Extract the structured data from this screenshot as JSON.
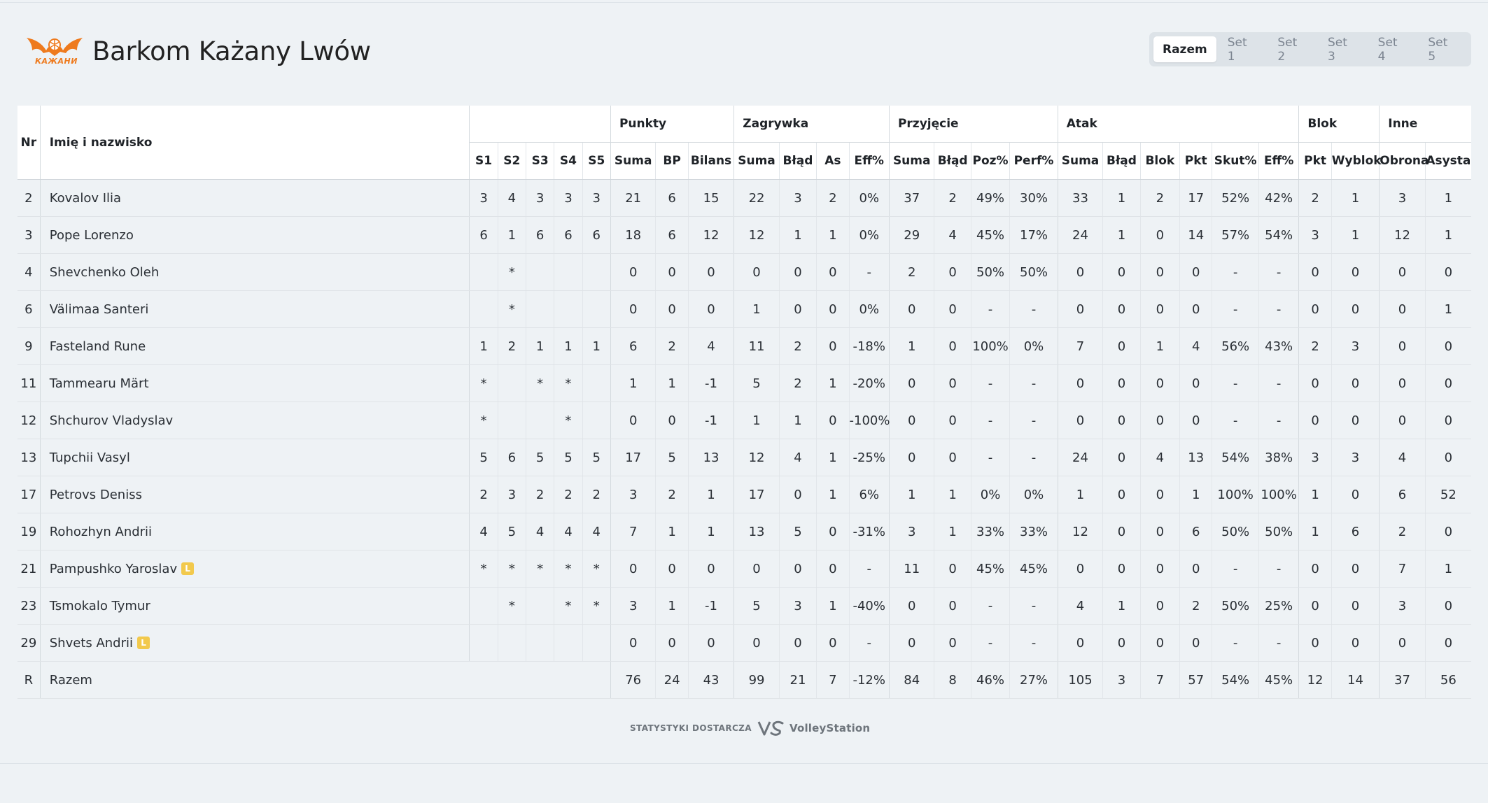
{
  "header": {
    "logo_text": "КАЖАНИ",
    "team_name": "Barkom Każany Lwów"
  },
  "tabs": [
    {
      "label": "Razem",
      "active": true
    },
    {
      "label": "Set 1",
      "active": false
    },
    {
      "label": "Set 2",
      "active": false
    },
    {
      "label": "Set 3",
      "active": false
    },
    {
      "label": "Set 4",
      "active": false
    },
    {
      "label": "Set 5",
      "active": false
    }
  ],
  "table": {
    "head": {
      "nr": "Nr",
      "name": "Imię i nazwisko",
      "groups": {
        "punkty": "Punkty",
        "zagrywka": "Zagrywka",
        "przyjecie": "Przyjęcie",
        "atak": "Atak",
        "blok": "Blok",
        "inne": "Inne"
      },
      "sets": [
        "S1",
        "S2",
        "S3",
        "S4",
        "S5"
      ],
      "punkty": [
        "Suma",
        "BP",
        "Bilans"
      ],
      "zagrywka": [
        "Suma",
        "Błąd",
        "As",
        "Eff%"
      ],
      "przyjecie": [
        "Suma",
        "Błąd",
        "Poz%",
        "Perf%"
      ],
      "atak": [
        "Suma",
        "Błąd",
        "Blok",
        "Pkt",
        "Skut%",
        "Eff%"
      ],
      "blok": [
        "Pkt",
        "Wyblok"
      ],
      "inne": [
        "Obrona",
        "Asysta"
      ]
    },
    "rows": [
      {
        "nr": "2",
        "name": "Kovalov Ilia",
        "libero": false,
        "sets": [
          "3",
          "4",
          "3",
          "3",
          "3"
        ],
        "punkty": [
          "21",
          "6",
          "15"
        ],
        "zagrywka": [
          "22",
          "3",
          "2",
          "0%"
        ],
        "przyjecie": [
          "37",
          "2",
          "49%",
          "30%"
        ],
        "atak": [
          "33",
          "1",
          "2",
          "17",
          "52%",
          "42%"
        ],
        "blok": [
          "2",
          "1"
        ],
        "inne": [
          "3",
          "1"
        ]
      },
      {
        "nr": "3",
        "name": "Pope Lorenzo",
        "libero": false,
        "sets": [
          "6",
          "1",
          "6",
          "6",
          "6"
        ],
        "punkty": [
          "18",
          "6",
          "12"
        ],
        "zagrywka": [
          "12",
          "1",
          "1",
          "0%"
        ],
        "przyjecie": [
          "29",
          "4",
          "45%",
          "17%"
        ],
        "atak": [
          "24",
          "1",
          "0",
          "14",
          "57%",
          "54%"
        ],
        "blok": [
          "3",
          "1"
        ],
        "inne": [
          "12",
          "1"
        ]
      },
      {
        "nr": "4",
        "name": "Shevchenko Oleh",
        "libero": false,
        "sets": [
          "",
          "*",
          "",
          "",
          ""
        ],
        "punkty": [
          "0",
          "0",
          "0"
        ],
        "zagrywka": [
          "0",
          "0",
          "0",
          "-"
        ],
        "przyjecie": [
          "2",
          "0",
          "50%",
          "50%"
        ],
        "atak": [
          "0",
          "0",
          "0",
          "0",
          "-",
          "-"
        ],
        "blok": [
          "0",
          "0"
        ],
        "inne": [
          "0",
          "0"
        ]
      },
      {
        "nr": "6",
        "name": "Välimaa Santeri",
        "libero": false,
        "sets": [
          "",
          "*",
          "",
          "",
          ""
        ],
        "punkty": [
          "0",
          "0",
          "0"
        ],
        "zagrywka": [
          "1",
          "0",
          "0",
          "0%"
        ],
        "przyjecie": [
          "0",
          "0",
          "-",
          "-"
        ],
        "atak": [
          "0",
          "0",
          "0",
          "0",
          "-",
          "-"
        ],
        "blok": [
          "0",
          "0"
        ],
        "inne": [
          "0",
          "1"
        ]
      },
      {
        "nr": "9",
        "name": "Fasteland Rune",
        "libero": false,
        "sets": [
          "1",
          "2",
          "1",
          "1",
          "1"
        ],
        "punkty": [
          "6",
          "2",
          "4"
        ],
        "zagrywka": [
          "11",
          "2",
          "0",
          "-18%"
        ],
        "przyjecie": [
          "1",
          "0",
          "100%",
          "0%"
        ],
        "atak": [
          "7",
          "0",
          "1",
          "4",
          "56%",
          "43%"
        ],
        "blok": [
          "2",
          "3"
        ],
        "inne": [
          "0",
          "0"
        ]
      },
      {
        "nr": "11",
        "name": "Tammearu Märt",
        "libero": false,
        "sets": [
          "*",
          "",
          "*",
          "*",
          ""
        ],
        "punkty": [
          "1",
          "1",
          "-1"
        ],
        "zagrywka": [
          "5",
          "2",
          "1",
          "-20%"
        ],
        "przyjecie": [
          "0",
          "0",
          "-",
          "-"
        ],
        "atak": [
          "0",
          "0",
          "0",
          "0",
          "-",
          "-"
        ],
        "blok": [
          "0",
          "0"
        ],
        "inne": [
          "0",
          "0"
        ]
      },
      {
        "nr": "12",
        "name": "Shchurov Vladyslav",
        "libero": false,
        "sets": [
          "*",
          "",
          "",
          "*",
          ""
        ],
        "punkty": [
          "0",
          "0",
          "-1"
        ],
        "zagrywka": [
          "1",
          "1",
          "0",
          "-100%"
        ],
        "przyjecie": [
          "0",
          "0",
          "-",
          "-"
        ],
        "atak": [
          "0",
          "0",
          "0",
          "0",
          "-",
          "-"
        ],
        "blok": [
          "0",
          "0"
        ],
        "inne": [
          "0",
          "0"
        ]
      },
      {
        "nr": "13",
        "name": "Tupchii Vasyl",
        "libero": false,
        "sets": [
          "5",
          "6",
          "5",
          "5",
          "5"
        ],
        "punkty": [
          "17",
          "5",
          "13"
        ],
        "zagrywka": [
          "12",
          "4",
          "1",
          "-25%"
        ],
        "przyjecie": [
          "0",
          "0",
          "-",
          "-"
        ],
        "atak": [
          "24",
          "0",
          "4",
          "13",
          "54%",
          "38%"
        ],
        "blok": [
          "3",
          "3"
        ],
        "inne": [
          "4",
          "0"
        ]
      },
      {
        "nr": "17",
        "name": "Petrovs Deniss",
        "libero": false,
        "sets": [
          "2",
          "3",
          "2",
          "2",
          "2"
        ],
        "punkty": [
          "3",
          "2",
          "1"
        ],
        "zagrywka": [
          "17",
          "0",
          "1",
          "6%"
        ],
        "przyjecie": [
          "1",
          "1",
          "0%",
          "0%"
        ],
        "atak": [
          "1",
          "0",
          "0",
          "1",
          "100%",
          "100%"
        ],
        "blok": [
          "1",
          "0"
        ],
        "inne": [
          "6",
          "52"
        ]
      },
      {
        "nr": "19",
        "name": "Rohozhyn Andrii",
        "libero": false,
        "sets": [
          "4",
          "5",
          "4",
          "4",
          "4"
        ],
        "punkty": [
          "7",
          "1",
          "1"
        ],
        "zagrywka": [
          "13",
          "5",
          "0",
          "-31%"
        ],
        "przyjecie": [
          "3",
          "1",
          "33%",
          "33%"
        ],
        "atak": [
          "12",
          "0",
          "0",
          "6",
          "50%",
          "50%"
        ],
        "blok": [
          "1",
          "6"
        ],
        "inne": [
          "2",
          "0"
        ]
      },
      {
        "nr": "21",
        "name": "Pampushko Yaroslav",
        "libero": true,
        "sets": [
          "*",
          "*",
          "*",
          "*",
          "*"
        ],
        "punkty": [
          "0",
          "0",
          "0"
        ],
        "zagrywka": [
          "0",
          "0",
          "0",
          "-"
        ],
        "przyjecie": [
          "11",
          "0",
          "45%",
          "45%"
        ],
        "atak": [
          "0",
          "0",
          "0",
          "0",
          "-",
          "-"
        ],
        "blok": [
          "0",
          "0"
        ],
        "inne": [
          "7",
          "1"
        ]
      },
      {
        "nr": "23",
        "name": "Tsmokalo Tymur",
        "libero": false,
        "sets": [
          "",
          "*",
          "",
          "*",
          "*"
        ],
        "punkty": [
          "3",
          "1",
          "-1"
        ],
        "zagrywka": [
          "5",
          "3",
          "1",
          "-40%"
        ],
        "przyjecie": [
          "0",
          "0",
          "-",
          "-"
        ],
        "atak": [
          "4",
          "1",
          "0",
          "2",
          "50%",
          "25%"
        ],
        "blok": [
          "0",
          "0"
        ],
        "inne": [
          "3",
          "0"
        ]
      },
      {
        "nr": "29",
        "name": "Shvets Andrii",
        "libero": true,
        "sets": [
          "",
          "",
          "",
          "",
          ""
        ],
        "punkty": [
          "0",
          "0",
          "0"
        ],
        "zagrywka": [
          "0",
          "0",
          "0",
          "-"
        ],
        "przyjecie": [
          "0",
          "0",
          "-",
          "-"
        ],
        "atak": [
          "0",
          "0",
          "0",
          "0",
          "-",
          "-"
        ],
        "blok": [
          "0",
          "0"
        ],
        "inne": [
          "0",
          "0"
        ]
      }
    ],
    "total": {
      "nr": "R",
      "name": "Razem",
      "punkty": [
        "76",
        "24",
        "43"
      ],
      "zagrywka": [
        "99",
        "21",
        "7",
        "-12%"
      ],
      "przyjecie": [
        "84",
        "8",
        "46%",
        "27%"
      ],
      "atak": [
        "105",
        "3",
        "7",
        "57",
        "54%",
        "45%"
      ],
      "blok": [
        "12",
        "14"
      ],
      "inne": [
        "37",
        "56"
      ]
    },
    "libero_badge": "L"
  },
  "footer": {
    "prefix": "STATYSTYKI DOSTARCZA",
    "brand": "VolleyStation"
  },
  "colors": {
    "background": "#eef2f5",
    "accent_orange": "#ee7a1d",
    "libero_badge": "#f2c94c"
  }
}
